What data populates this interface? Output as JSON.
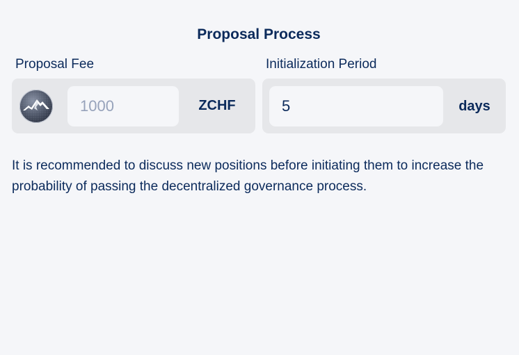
{
  "section": {
    "title": "Proposal Process"
  },
  "proposal_fee": {
    "label": "Proposal Fee",
    "placeholder": "1000",
    "value": "",
    "currency": "ZCHF",
    "icon": "zchf-mountain-coin-icon"
  },
  "initialization_period": {
    "label": "Initialization Period",
    "value": "5",
    "unit": "days"
  },
  "note": "It is recommended to discuss new positions before initiating them to increase the probability of passing the decentralized governance process."
}
